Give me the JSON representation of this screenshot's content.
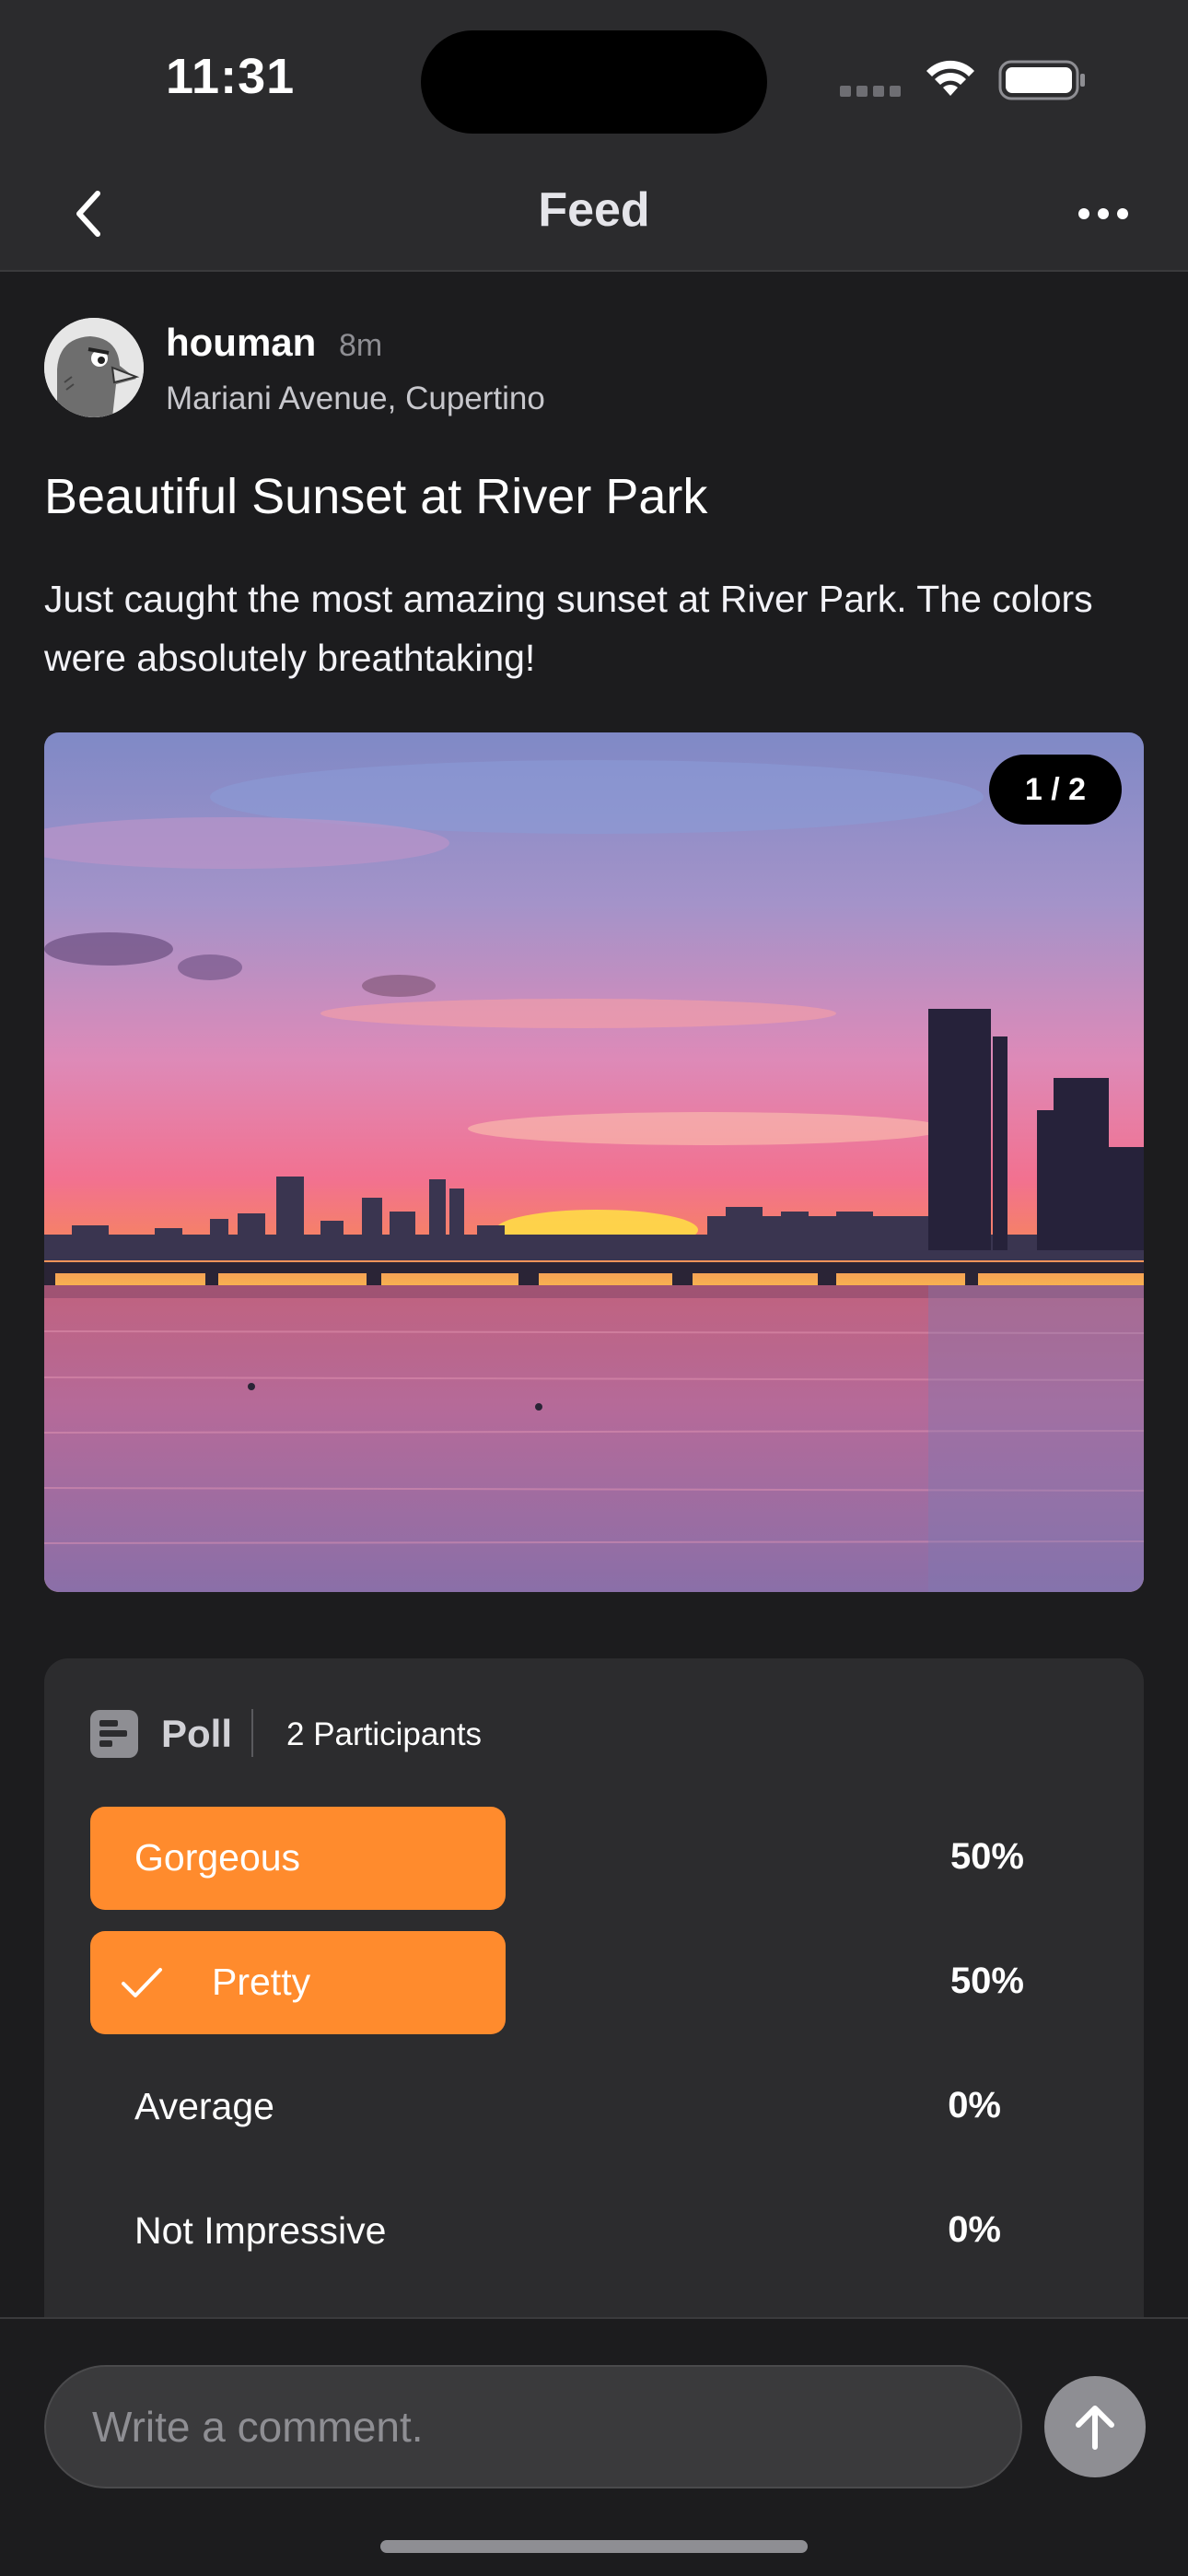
{
  "status_bar": {
    "time": "11:31"
  },
  "nav": {
    "title": "Feed",
    "back_icon": "chevron-left-icon",
    "more_icon": "ellipsis-icon"
  },
  "post": {
    "author": "houman",
    "time_ago": "8m",
    "location": "Mariani Avenue, Cupertino",
    "title": "Beautiful Sunset at River Park",
    "body": "Just caught the most amazing sunset at River Park. The colors were absolutely breathtaking!",
    "photo": {
      "indicator": "1 / 2",
      "current": 1,
      "total": 2
    }
  },
  "poll": {
    "label": "Poll",
    "participants": "2 Participants",
    "accent_color": "#ff8b2d",
    "options": [
      {
        "label": "Gorgeous",
        "percent": "50%",
        "fraction": 0.5,
        "selected": false
      },
      {
        "label": "Pretty",
        "percent": "50%",
        "fraction": 0.5,
        "selected": true
      },
      {
        "label": "Average",
        "percent": "0%",
        "fraction": 0,
        "selected": false
      },
      {
        "label": "Not Impressive",
        "percent": "0%",
        "fraction": 0,
        "selected": false
      }
    ]
  },
  "comment": {
    "placeholder": "Write a comment.",
    "send_icon": "arrow-up-icon"
  }
}
